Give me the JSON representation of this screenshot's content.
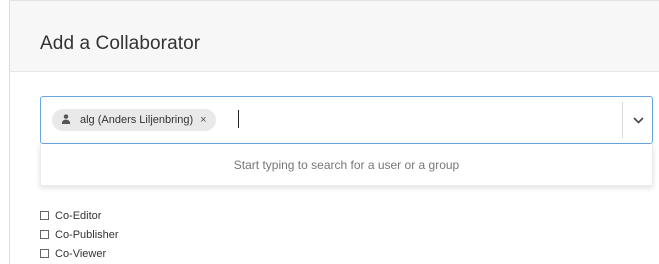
{
  "dialog": {
    "title": "Add a Collaborator"
  },
  "select": {
    "token": {
      "label": "alg (Anders Liljenbring)",
      "icon": "user-icon",
      "remove_symbol": "×"
    },
    "input_value": "",
    "dropdown_icon": "chevron-down-icon",
    "hint": "Start typing to search for a user or a group"
  },
  "roles": [
    {
      "label": "Co-Editor",
      "checked": false
    },
    {
      "label": "Co-Publisher",
      "checked": false
    },
    {
      "label": "Co-Viewer",
      "checked": false
    }
  ],
  "colors": {
    "focus_border": "#6aa6de",
    "header_bg": "#f7f7f7",
    "token_bg": "#e9e9e9"
  }
}
